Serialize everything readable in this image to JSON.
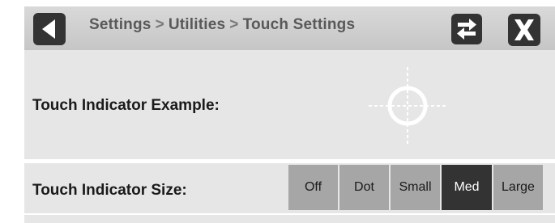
{
  "header": {
    "breadcrumb": [
      "Settings",
      "Utilities",
      "Touch Settings"
    ],
    "separator": ">",
    "back_icon": "back-triangle-icon",
    "swap_icon": "swap-arrows-icon",
    "close_icon": "close-x-icon"
  },
  "example_row": {
    "label": "Touch Indicator Example:",
    "indicator_icon": "crosshair-circle-icon"
  },
  "size_row": {
    "label": "Touch Indicator Size:",
    "options": [
      "Off",
      "Dot",
      "Small",
      "Med",
      "Large"
    ],
    "selected": "Med"
  },
  "colors": {
    "header_bg": "#cfcfcf",
    "row_bg": "#e6e6e6",
    "button_dark": "#333333",
    "segment_bg": "#a6a6a6",
    "segment_selected_bg": "#333333",
    "indicator": "#ffffff"
  }
}
